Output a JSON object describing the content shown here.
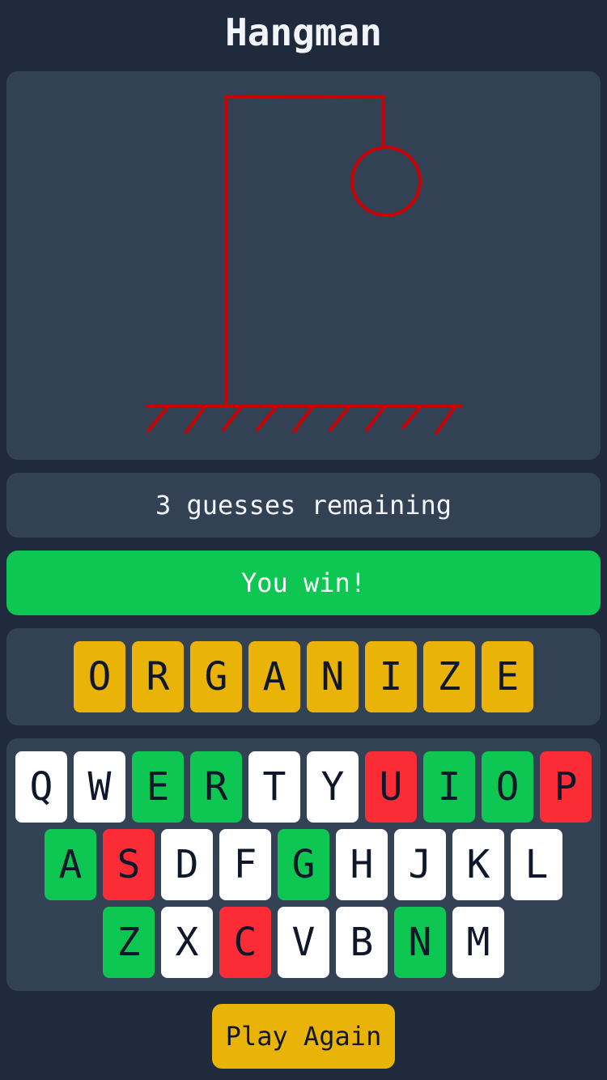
{
  "app": {
    "title": "Hangman"
  },
  "status": {
    "text": "3 guesses remaining"
  },
  "result": {
    "text": "You win!"
  },
  "word": {
    "letters": [
      "O",
      "R",
      "G",
      "A",
      "N",
      "I",
      "Z",
      "E"
    ]
  },
  "keyboard": {
    "rows": [
      [
        {
          "letter": "Q",
          "state": "unused"
        },
        {
          "letter": "W",
          "state": "unused"
        },
        {
          "letter": "E",
          "state": "correct"
        },
        {
          "letter": "R",
          "state": "correct"
        },
        {
          "letter": "T",
          "state": "unused"
        },
        {
          "letter": "Y",
          "state": "unused"
        },
        {
          "letter": "U",
          "state": "wrong"
        },
        {
          "letter": "I",
          "state": "correct"
        },
        {
          "letter": "O",
          "state": "correct"
        },
        {
          "letter": "P",
          "state": "wrong"
        }
      ],
      [
        {
          "letter": "A",
          "state": "correct"
        },
        {
          "letter": "S",
          "state": "wrong"
        },
        {
          "letter": "D",
          "state": "unused"
        },
        {
          "letter": "F",
          "state": "unused"
        },
        {
          "letter": "G",
          "state": "correct"
        },
        {
          "letter": "H",
          "state": "unused"
        },
        {
          "letter": "J",
          "state": "unused"
        },
        {
          "letter": "K",
          "state": "unused"
        },
        {
          "letter": "L",
          "state": "unused"
        }
      ],
      [
        {
          "letter": "Z",
          "state": "correct"
        },
        {
          "letter": "X",
          "state": "unused"
        },
        {
          "letter": "C",
          "state": "wrong"
        },
        {
          "letter": "V",
          "state": "unused"
        },
        {
          "letter": "B",
          "state": "unused"
        },
        {
          "letter": "N",
          "state": "correct"
        },
        {
          "letter": "M",
          "state": "unused"
        }
      ]
    ]
  },
  "actions": {
    "play_again_label": "Play Again"
  },
  "colors": {
    "background": "#1f2a3d",
    "panel": "#334155",
    "correct": "#0ec652",
    "wrong": "#fb2c36",
    "tile": "#eab308",
    "gallows": "#cc0000"
  }
}
